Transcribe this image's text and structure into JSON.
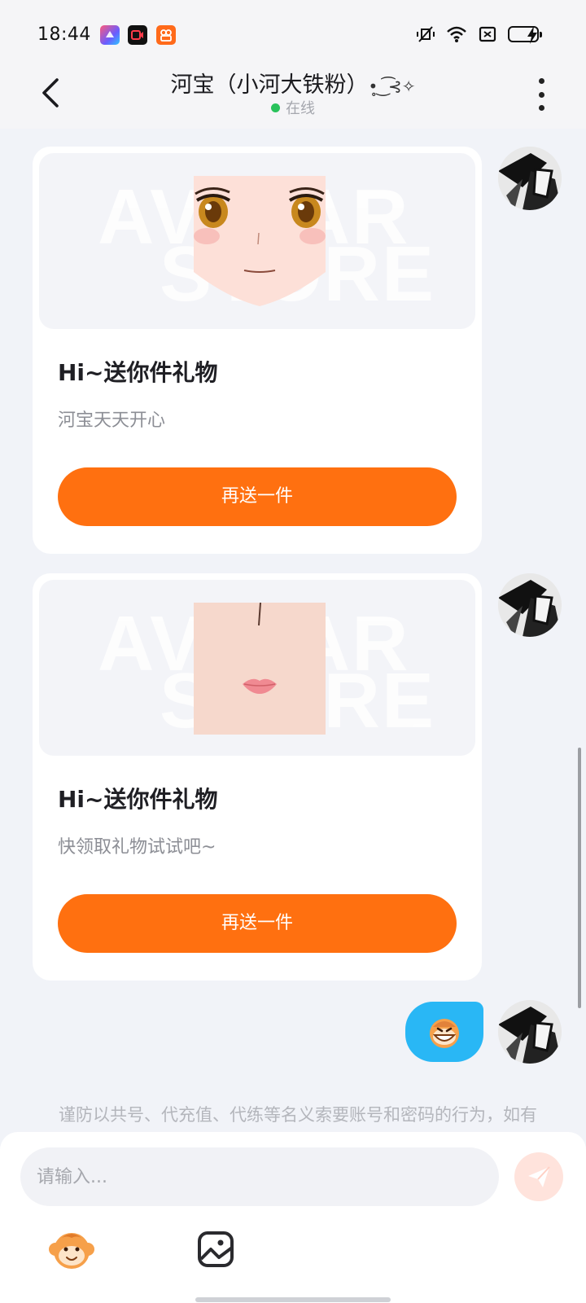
{
  "status_bar": {
    "time": "18:44",
    "apps": [
      "shortcuts-app-icon",
      "screen-recorder-app-icon",
      "video-app-icon"
    ],
    "icons": [
      "vibrate-mute-icon",
      "wifi-icon",
      "sim-icon",
      "battery-icon",
      "charging-icon"
    ]
  },
  "header": {
    "title": "河宝（小河大铁粉）",
    "title_deco": "•̥ ͜ ͡⊰✧",
    "status": "在线",
    "status_color": "#29c25b"
  },
  "messages": [
    {
      "type": "gift-card",
      "gift_image": "anime-face-eyes-gift",
      "title": "Hi~送你件礼物",
      "subtitle": "河宝天天开心",
      "button": "再送一件"
    },
    {
      "type": "gift-card",
      "gift_image": "face-lips-gift",
      "title": "Hi~送你件礼物",
      "subtitle": "快领取礼物试试吧~",
      "button": "再送一件"
    },
    {
      "type": "emoji",
      "emoji": "grinning-monkey-emoji"
    }
  ],
  "watermark": [
    "AVATAR",
    "STORE"
  ],
  "notice": "谨防以共号、代充值、代练等名义索要账号和密码的行为，如有疑似诈骗风险请立即停止交易，保护好自身财产安全",
  "composer": {
    "placeholder": "请输入...",
    "send_icon": "send-icon",
    "tools": [
      "monkey-emoji-icon",
      "image-icon"
    ]
  },
  "colors": {
    "accent": "#ff7010",
    "bubble": "#29b7f5",
    "background": "#f1f3f8"
  }
}
